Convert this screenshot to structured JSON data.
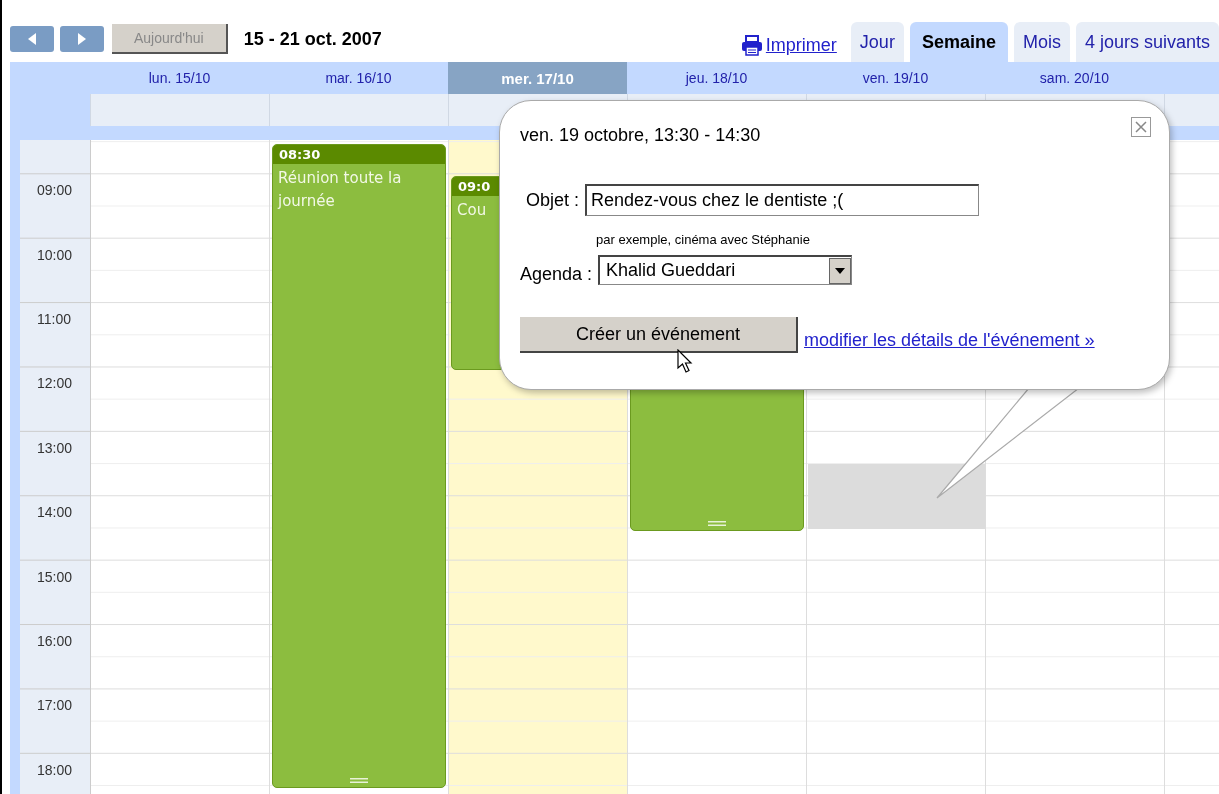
{
  "toolbar": {
    "today_button": {
      "label": "Aujourd'hui",
      "disabled": true
    },
    "date_range": "15 - 21 oct. 2007",
    "print_link": "Imprimer",
    "view_tabs": [
      {
        "label": "Jour",
        "selected": false
      },
      {
        "label": "Semaine",
        "selected": true
      },
      {
        "label": "Mois",
        "selected": false
      },
      {
        "label": "4 jours suivants",
        "selected": false
      }
    ]
  },
  "days": [
    {
      "label": "lun. 15/10",
      "selected": false,
      "today": false
    },
    {
      "label": "mar. 16/10",
      "selected": false,
      "today": false,
      "events": [
        {
          "kind": "titled",
          "time": "08:30",
          "title": "Réunion toute la journée"
        }
      ]
    },
    {
      "label": "mer. 17/10",
      "selected": true,
      "today": true,
      "events": [
        {
          "kind": "titled",
          "time": "09:0",
          "title": "Cou"
        }
      ]
    },
    {
      "label": "jeu. 18/10",
      "selected": false,
      "today": false,
      "events": [
        {
          "kind": "untitled"
        }
      ]
    },
    {
      "label": "ven. 19/10",
      "selected": false,
      "today": false,
      "selection": true
    },
    {
      "label": "sam. 20/10",
      "selected": false,
      "today": false
    }
  ],
  "hours": [
    "09:00",
    "10:00",
    "11:00",
    "12:00",
    "13:00",
    "14:00",
    "15:00",
    "16:00",
    "17:00",
    "18:00"
  ],
  "popup": {
    "date": "ven. 19 octobre, 13:30 - 14:30",
    "subject_label": "Objet :",
    "subject_value": "Rendez-vous chez le dentiste ;(",
    "hint": "par exemple, cinéma avec Stéphanie",
    "calendar_label": "Agenda :",
    "calendar_value": "Khalid Gueddari",
    "create_button": "Créer un événement",
    "details_link": "modifier les détails de l'événement »"
  }
}
